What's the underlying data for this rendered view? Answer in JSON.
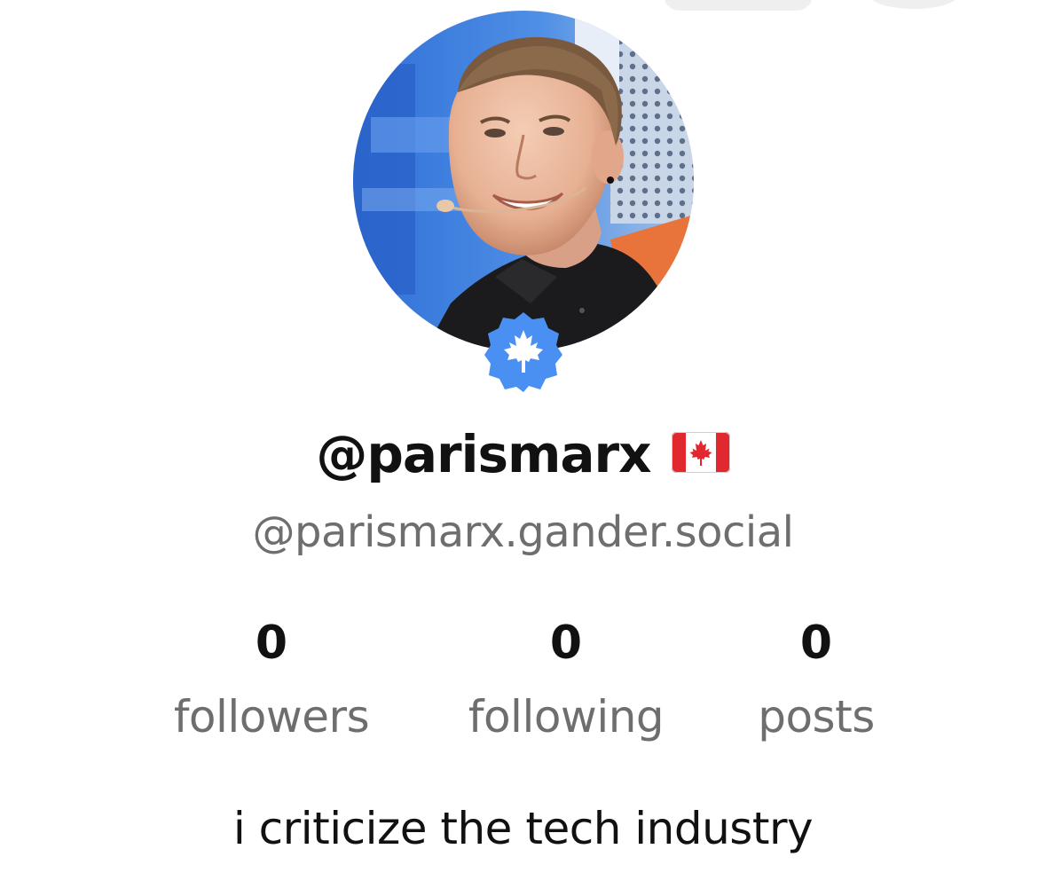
{
  "profile": {
    "display_name": "@parismarx",
    "flag": "canada-flag-icon",
    "handle": "@parismarx.gander.social",
    "bio": "i criticize the tech industry",
    "verified_badge": "maple-leaf-verified-icon"
  },
  "stats": [
    {
      "count": "0",
      "label": "followers"
    },
    {
      "count": "0",
      "label": "following"
    },
    {
      "count": "0",
      "label": "posts"
    }
  ],
  "colors": {
    "badge_blue": "#4a90f2",
    "flag_red": "#e0282e",
    "secondary_text": "#6e6e6e",
    "primary_text": "#111111"
  }
}
